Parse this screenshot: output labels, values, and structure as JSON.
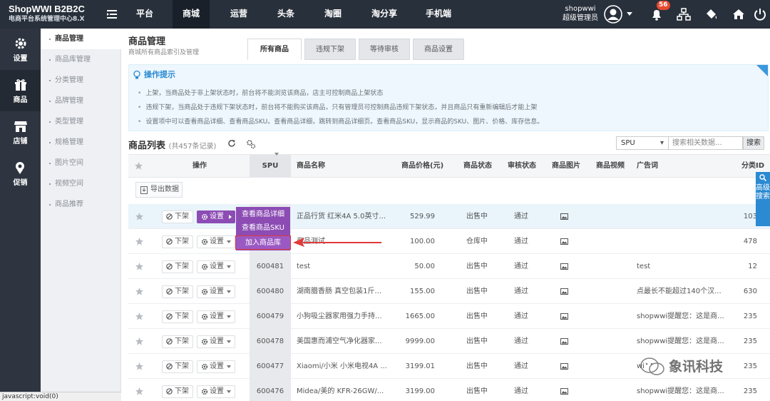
{
  "header": {
    "brand_title": "ShopWWI B2B2C",
    "brand_subtitle": "电商平台系统管理中心8.X",
    "nav": [
      "平台",
      "商城",
      "运营",
      "头条",
      "淘圈",
      "淘分享",
      "手机端"
    ],
    "active_nav": "商城",
    "user_name": "shopwwi",
    "user_role": "超级管理员",
    "notification_count": "56"
  },
  "sidebar": {
    "categories": [
      {
        "label": "设置",
        "icon": "gear-icon"
      },
      {
        "label": "商品",
        "icon": "gift-icon"
      },
      {
        "label": "店铺",
        "icon": "store-icon"
      },
      {
        "label": "促销",
        "icon": "promotion-icon"
      }
    ],
    "submenu": [
      "商品管理",
      "商品库管理",
      "分类管理",
      "品牌管理",
      "类型管理",
      "规格管理",
      "图片空间",
      "视频空间",
      "商品推荐"
    ]
  },
  "page": {
    "title": "商品管理",
    "subtitle": "商城所有商品索引及管理",
    "tabs": [
      "所有商品",
      "违规下架",
      "等待审核",
      "商品设置"
    ]
  },
  "tips": {
    "title": "操作提示",
    "items": [
      "上架，当商品处于非上架状态时，前台将不能浏览该商品，店主可控制商品上架状态",
      "违规下架，当商品处于违规下架状态时，前台将不能购买该商品，只有管理员可控制商品违规下架状态，并且商品只有重新编辑后才能上架",
      "设置项中可以查看商品详细、查看商品SKU。查看商品详细，跳转到商品详细页。查看商品SKU，显示商品的SKU、图片、价格、库存信息。"
    ]
  },
  "list": {
    "title": "商品列表",
    "count_text": "(共457条记录)",
    "search_select": "SPU",
    "search_placeholder": "搜索相关数据...",
    "search_button": "搜索",
    "export_label": "导出数据",
    "columns": [
      "操作",
      "SPU",
      "商品名称",
      "商品价格(元)",
      "商品状态",
      "审核状态",
      "商品图片",
      "商品视频",
      "广告词",
      "分类ID"
    ],
    "off_label": "下架",
    "settings_label": "设置",
    "rows": [
      {
        "spu": "",
        "name": "正品行货 红米4A 5.0英寸...",
        "price": "529.99",
        "status": "出售中",
        "audit": "通过",
        "ad": "",
        "cat": "103"
      },
      {
        "spu": "",
        "name": "商品测试",
        "price": "100.00",
        "status": "仓库中",
        "audit": "通过",
        "ad": "",
        "cat": "478"
      },
      {
        "spu": "600481",
        "name": "test",
        "price": "50.00",
        "status": "出售中",
        "audit": "通过",
        "ad": "test",
        "cat": "12"
      },
      {
        "spu": "600480",
        "name": "湖南腊香肠 真空包装1斤...",
        "price": "155.00",
        "status": "出售中",
        "audit": "通过",
        "ad": "点最长不能超过140个汉...",
        "cat": "630"
      },
      {
        "spu": "600479",
        "name": "小狗吸尘器家用强力手持...",
        "price": "1665.00",
        "status": "出售中",
        "audit": "通过",
        "ad": "shopwwi提醒您：这是商...",
        "cat": "235"
      },
      {
        "spu": "600478",
        "name": "美国惠而浦空气净化器家...",
        "price": "9999.00",
        "status": "出售中",
        "audit": "通过",
        "ad": "shopwwi提醒您：这是商...",
        "cat": "235"
      },
      {
        "spu": "600477",
        "name": "Xiaomi/小米 小米电视4A ...",
        "price": "3199.01",
        "status": "出售中",
        "audit": "通过",
        "ad": "wi",
        "cat": "235"
      },
      {
        "spu": "600476",
        "name": "Midea/美的 KFR-26GW/...",
        "price": "3199.00",
        "status": "出售中",
        "audit": "通过",
        "ad": "shopwwi提醒您：这是商...",
        "cat": "235"
      }
    ]
  },
  "dropdown": {
    "items": [
      "查看商品详细",
      "查看商品SKU",
      "加入商品库"
    ],
    "selected": "加入商品库"
  },
  "advanced_search": "高级搜索",
  "status_bar": "javascript:void(0)",
  "watermark": "象讯科技",
  "colors": {
    "topbar": "#28303b",
    "accent_purple": "#8c4cb4",
    "tip_blue": "#2b8ad2",
    "badge_red": "#e64a2e"
  }
}
